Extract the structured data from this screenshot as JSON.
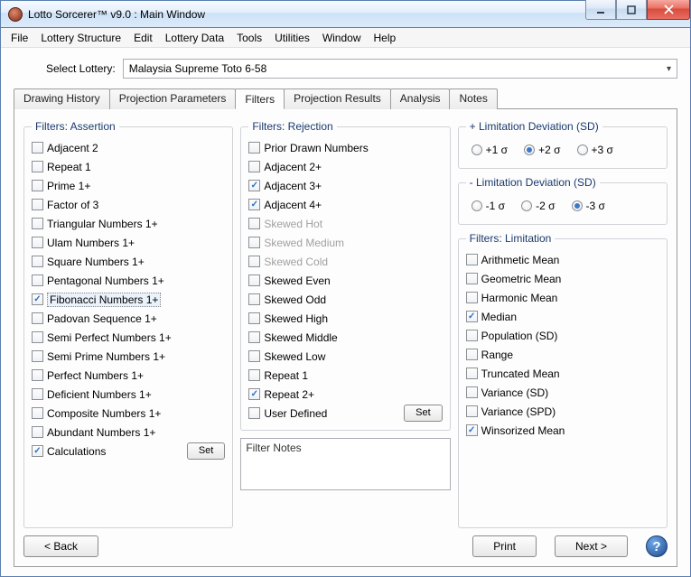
{
  "title": "Lotto Sorcerer™ v9.0 : Main Window",
  "menu": [
    "File",
    "Lottery Structure",
    "Edit",
    "Lottery Data",
    "Tools",
    "Utilities",
    "Window",
    "Help"
  ],
  "select_lottery_label": "Select Lottery:",
  "selected_lottery": "Malaysia Supreme Toto 6-58",
  "tabs": [
    "Drawing History",
    "Projection Parameters",
    "Filters",
    "Projection Results",
    "Analysis",
    "Notes"
  ],
  "active_tab": 2,
  "assertion": {
    "title": "Filters: Assertion",
    "items": [
      {
        "label": "Adjacent 2",
        "checked": false
      },
      {
        "label": "Repeat 1",
        "checked": false
      },
      {
        "label": "Prime 1+",
        "checked": false
      },
      {
        "label": "Factor of 3",
        "checked": false
      },
      {
        "label": "Triangular Numbers 1+",
        "checked": false
      },
      {
        "label": "Ulam Numbers 1+",
        "checked": false
      },
      {
        "label": "Square Numbers 1+",
        "checked": false
      },
      {
        "label": "Pentagonal Numbers 1+",
        "checked": false
      },
      {
        "label": "Fibonacci Numbers 1+",
        "checked": true,
        "highlight": true
      },
      {
        "label": "Padovan Sequence 1+",
        "checked": false
      },
      {
        "label": "Semi Perfect Numbers 1+",
        "checked": false
      },
      {
        "label": "Semi Prime Numbers 1+",
        "checked": false
      },
      {
        "label": "Perfect Numbers 1+",
        "checked": false
      },
      {
        "label": "Deficient Numbers 1+",
        "checked": false
      },
      {
        "label": "Composite Numbers 1+",
        "checked": false
      },
      {
        "label": "Abundant Numbers 1+",
        "checked": false
      }
    ],
    "calc_label": "Calculations",
    "calc_checked": true,
    "set_label": "Set"
  },
  "rejection": {
    "title": "Filters: Rejection",
    "items": [
      {
        "label": "Prior Drawn Numbers",
        "checked": false
      },
      {
        "label": "Adjacent 2+",
        "checked": false
      },
      {
        "label": "Adjacent 3+",
        "checked": true
      },
      {
        "label": "Adjacent 4+",
        "checked": true
      },
      {
        "label": "Skewed Hot",
        "checked": false,
        "disabled": true
      },
      {
        "label": "Skewed Medium",
        "checked": false,
        "disabled": true
      },
      {
        "label": "Skewed Cold",
        "checked": false,
        "disabled": true
      },
      {
        "label": "Skewed Even",
        "checked": false
      },
      {
        "label": "Skewed Odd",
        "checked": false
      },
      {
        "label": "Skewed High",
        "checked": false
      },
      {
        "label": "Skewed Middle",
        "checked": false
      },
      {
        "label": "Skewed Low",
        "checked": false
      },
      {
        "label": "Repeat 1",
        "checked": false
      },
      {
        "label": "Repeat 2+",
        "checked": true
      }
    ],
    "user_defined_label": "User Defined",
    "user_defined_checked": false,
    "set_label": "Set"
  },
  "plus_dev": {
    "title": "+ Limitation Deviation (SD)",
    "options": [
      "+1 σ",
      "+2 σ",
      "+3 σ"
    ],
    "selected": 1
  },
  "minus_dev": {
    "title": "- Limitation Deviation (SD)",
    "options": [
      "-1 σ",
      "-2 σ",
      "-3 σ"
    ],
    "selected": 2
  },
  "limitation": {
    "title": "Filters: Limitation",
    "items": [
      {
        "label": "Arithmetic Mean",
        "checked": false
      },
      {
        "label": "Geometric Mean",
        "checked": false
      },
      {
        "label": "Harmonic Mean",
        "checked": false
      },
      {
        "label": "Median",
        "checked": true
      },
      {
        "label": "Population (SD)",
        "checked": false
      },
      {
        "label": "Range",
        "checked": false
      },
      {
        "label": "Truncated Mean",
        "checked": false
      },
      {
        "label": "Variance (SD)",
        "checked": false
      },
      {
        "label": "Variance (SPD)",
        "checked": false
      },
      {
        "label": "Winsorized Mean",
        "checked": true
      }
    ]
  },
  "notes_placeholder": "Filter Notes",
  "buttons": {
    "back": "<  Back",
    "print": "Print",
    "next": "Next  >"
  }
}
